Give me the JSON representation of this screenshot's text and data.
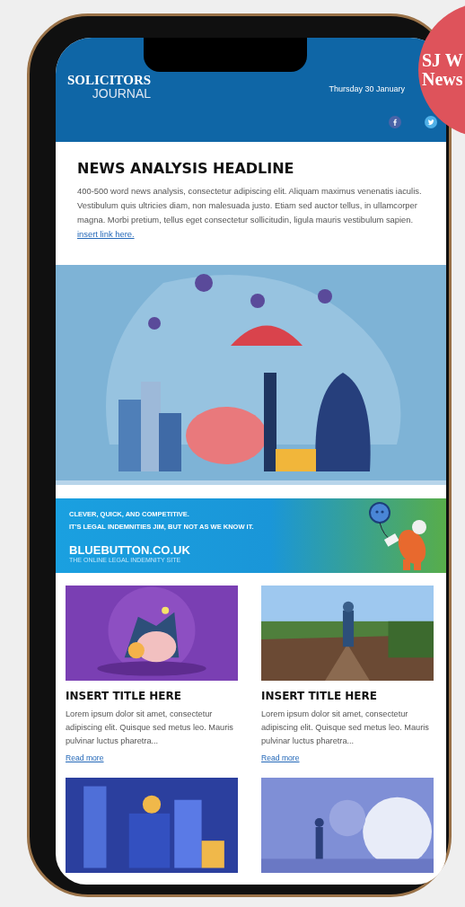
{
  "header": {
    "logo_top": "SOLICITORS",
    "logo_bottom": "JOURNAL",
    "date": "Thursday 30 January",
    "social": [
      {
        "kind": "facebook"
      },
      {
        "kind": "twitter"
      }
    ]
  },
  "badge": {
    "line_1": "SJ W",
    "line_2": "News"
  },
  "article": {
    "headline": "NEWS ANALYSIS HEADLINE",
    "body": "400-500 word news analysis, consectetur adipiscing elit. Aliquam maximus venenatis iaculis. Vestibulum quis ultricies diam, non malesuada justo. Etiam sed auctor tellus, in ullamcorper magna. Morbi pretium, tellus eget consectetur sollicitudin, ligula mauris vestibulum sapien.",
    "link": "insert link here."
  },
  "hero": {
    "kind": "picture"
  },
  "banner": {
    "line_1": "CLEVER, QUICK, AND COMPETITIVE.",
    "line_2": "IT'S LEGAL INDEMNITIES JIM, BUT NOT AS WE KNOW IT.",
    "brand": "BLUEBUTTON.CO.UK",
    "tagline": "THE ONLINE LEGAL INDEMNITY SITE"
  },
  "cards": [
    {
      "kind": "article",
      "title": "INSERT TITLE HERE",
      "excerpt": "Lorem ipsum dolor sit amet, consectetur adipiscing elit. Quisque sed metus leo. Mauris pulvinar luctus pharetra...",
      "link": "Read more"
    },
    {
      "kind": "article",
      "title": "INSERT TITLE HERE",
      "excerpt": "Lorem ipsum dolor sit amet, consectetur adipiscing elit. Quisque sed metus leo. Mauris pulvinar luctus pharetra...",
      "link": "Read more"
    },
    {
      "kind": "picture"
    },
    {
      "kind": "picture"
    }
  ]
}
